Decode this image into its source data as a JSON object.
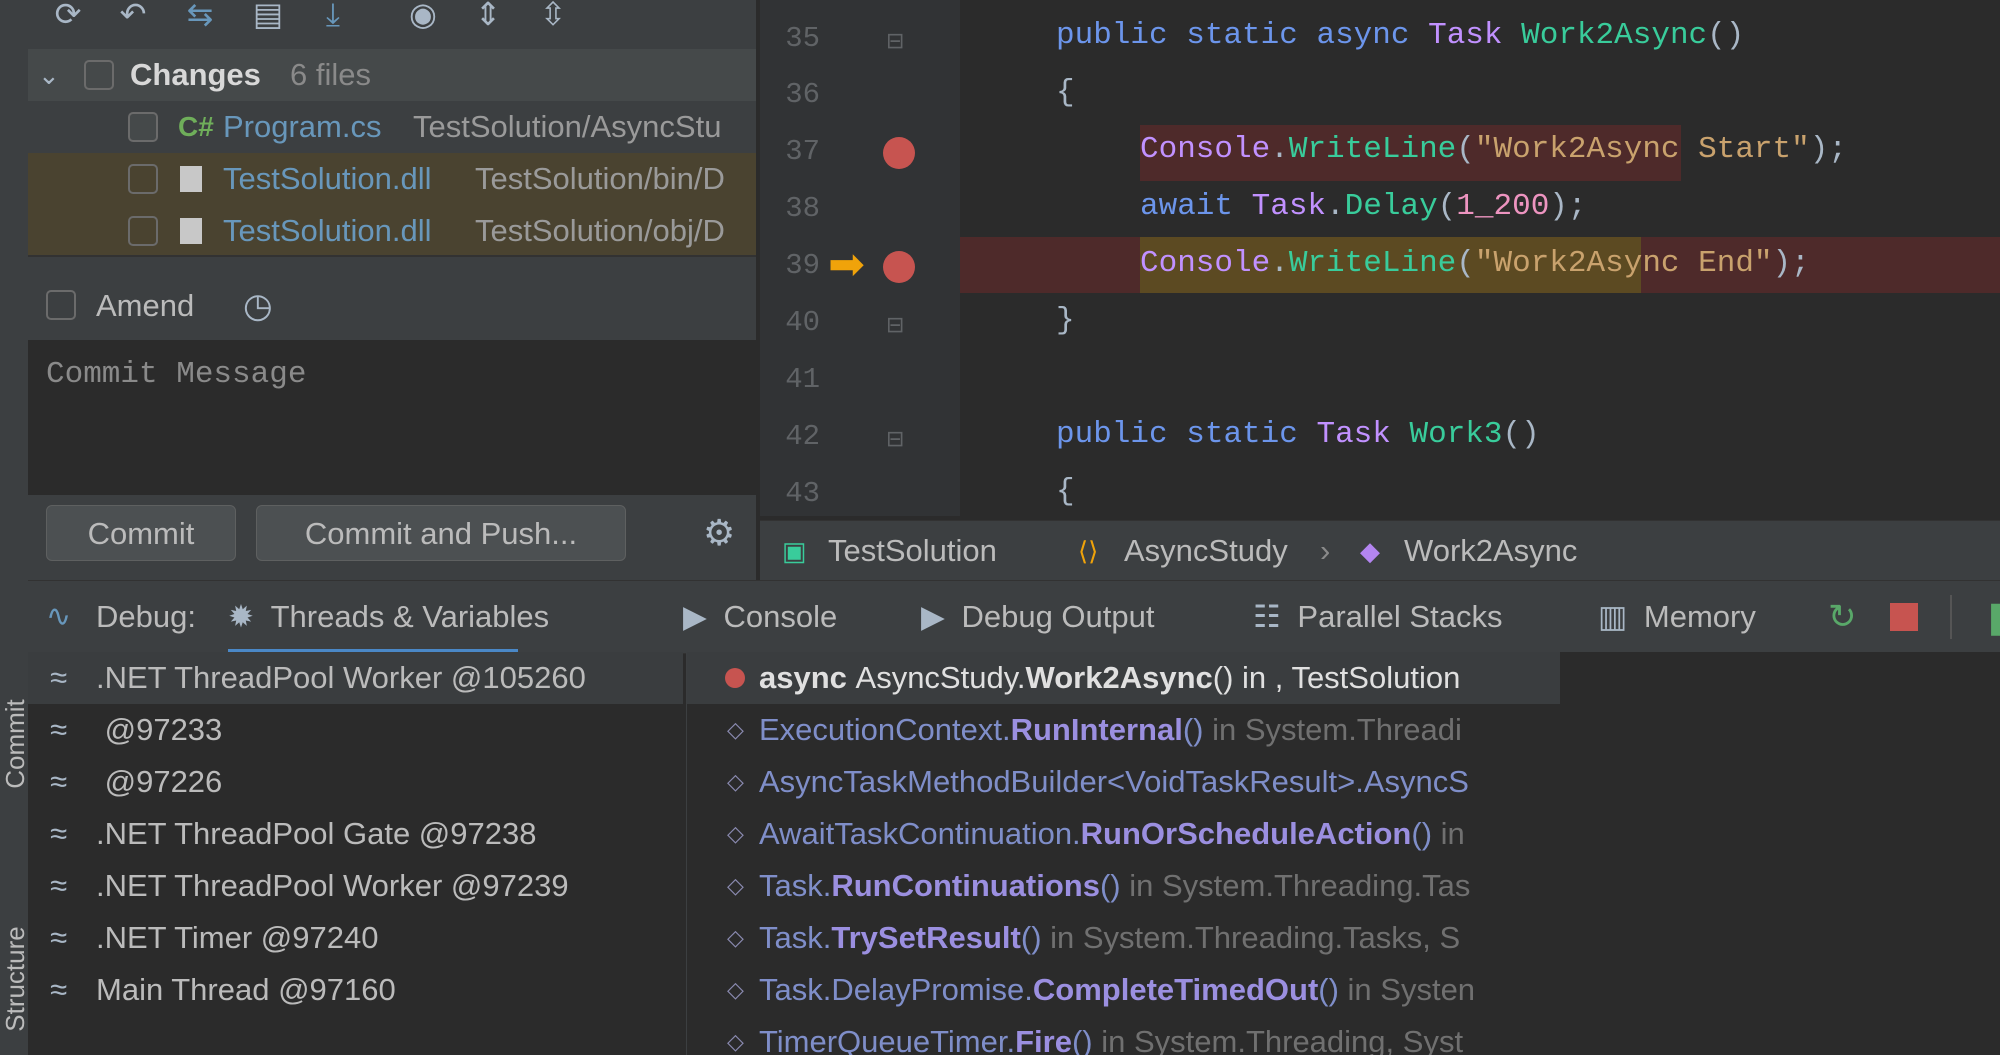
{
  "side_tabs": {
    "commit": "Commit",
    "structure": "Structure"
  },
  "toolbar": {
    "icons": [
      "refresh-icon",
      "undo-icon",
      "merge-icon",
      "shelve-icon",
      "update-icon",
      "preview-icon",
      "expand-all-icon",
      "collapse-all-icon"
    ]
  },
  "changes": {
    "title": "Changes",
    "count": "6 files",
    "files": [
      {
        "badge": "C#",
        "name": "Program.cs",
        "path": "TestSolution/AsyncStu"
      },
      {
        "name": "TestSolution.dll",
        "path": "TestSolution/bin/D"
      },
      {
        "name": "TestSolution.dll",
        "path": "TestSolution/obj/D"
      }
    ]
  },
  "amend": {
    "label": "Amend"
  },
  "commit_message": {
    "placeholder": "Commit Message"
  },
  "buttons": {
    "commit": "Commit",
    "commit_and_push": "Commit and Push..."
  },
  "editor": {
    "line_numbers": [
      "35",
      "36",
      "37",
      "38",
      "39",
      "40",
      "41",
      "42",
      "43"
    ],
    "line35": {
      "kw1": "public",
      "kw2": "static",
      "kw3": "async",
      "type": "Task",
      "method": "Work2Async",
      "rest": "()"
    },
    "line36": "{",
    "line37": {
      "cls": "Console",
      "dot": ".",
      "method": "WriteLine",
      "p1": "(",
      "str": "\"Work2Async Start\"",
      "p2": ");"
    },
    "line38": {
      "kw": "await",
      "cls": "Task",
      "dot": ".",
      "method": "Delay",
      "p1": "(",
      "num": "1_200",
      "p2": ");"
    },
    "line39": {
      "cls": "Console",
      "dot": ".",
      "method": "WriteLine",
      "p1": "(",
      "str": "\"Work2Async End\"",
      "p2": ");"
    },
    "line40": "}",
    "line42": {
      "kw1": "public",
      "kw2": "static",
      "type": "Task",
      "method": "Work3",
      "rest": "()"
    },
    "line43": "{"
  },
  "breadcrumb": {
    "project": "TestSolution",
    "class": "AsyncStudy",
    "method": "Work2Async"
  },
  "debug": {
    "label": "Debug:",
    "tabs": [
      "Threads & Variables",
      "Console",
      "Debug Output",
      "Parallel Stacks",
      "Memory"
    ]
  },
  "threads": [
    ".NET ThreadPool Worker @105260",
    " @97233",
    " @97226",
    ".NET ThreadPool Gate @97238",
    ".NET ThreadPool Worker @97239",
    ".NET Timer @97240",
    "Main Thread @97160"
  ],
  "frames": [
    {
      "pre": "async ",
      "cls": "AsyncStudy.",
      "method": "Work2Async",
      "args": "()",
      "in": " in , TestSolution"
    },
    {
      "cls": "ExecutionContext.",
      "method": "RunInternal",
      "args": "()",
      "in": " in System.Threadi"
    },
    {
      "cls": "AsyncTaskMethodBuilder<VoidTaskResult>.AsyncS",
      "method": "",
      "args": "",
      "in": ""
    },
    {
      "cls": "AwaitTaskContinuation.",
      "method": "RunOrScheduleAction",
      "args": "()",
      "in": " in"
    },
    {
      "cls": "Task.",
      "method": "RunContinuations",
      "args": "()",
      "in": " in System.Threading.Tas"
    },
    {
      "cls": "Task.",
      "method": "TrySetResult",
      "args": "()",
      "in": " in System.Threading.Tasks, S"
    },
    {
      "cls": "Task.DelayPromise.",
      "method": "CompleteTimedOut",
      "args": "()",
      "in": " in Systen"
    },
    {
      "cls": "TimerQueueTimer.",
      "method": "Fire",
      "args": "()",
      "in": " in System.Threading, Syst"
    }
  ],
  "colors": {
    "breakpoint": "#c75450",
    "execution_arrow": "#f0a30a",
    "error_line": "#4e2a2a"
  }
}
